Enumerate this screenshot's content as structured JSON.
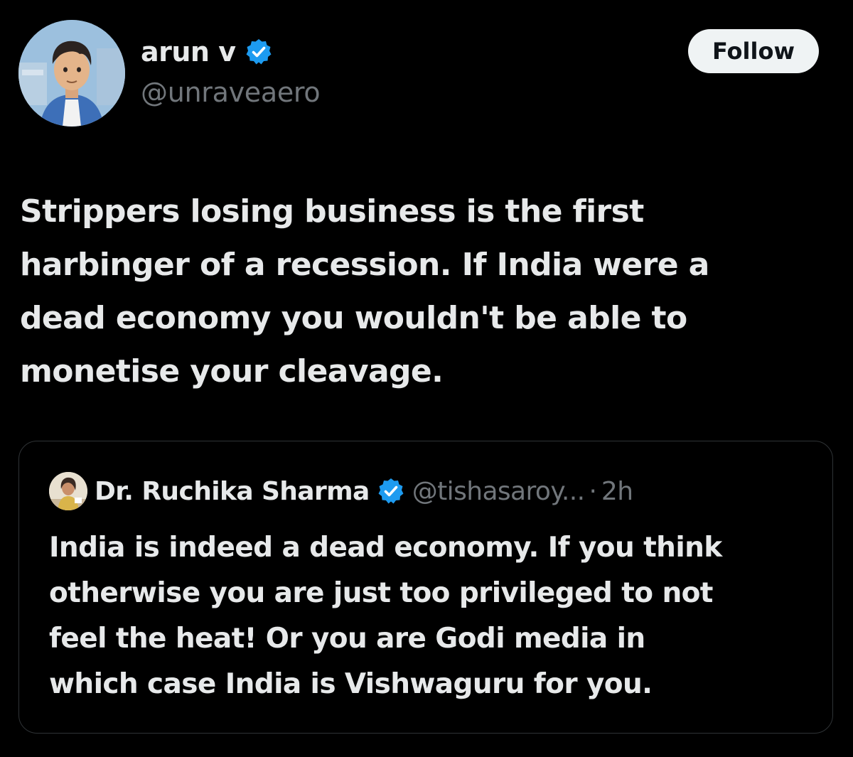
{
  "tweet": {
    "author": {
      "display_name": "arun v",
      "handle": "@unraveaero",
      "avatar_icon": "cartoon-man-avatar",
      "verified": true
    },
    "follow_label": "Follow",
    "text": "Strippers losing business is the first\nharbinger of a recession.  If India were a\ndead economy you wouldn't be able to\nmonetise your cleavage."
  },
  "quoted_tweet": {
    "author": {
      "display_name": "Dr. Ruchika Sharma",
      "handle": "@tishasaroy...",
      "avatar_icon": "woman-avatar",
      "verified": true
    },
    "separator": "·",
    "time": "2h",
    "text": "India is indeed a dead economy. If you think\notherwise you are just too privileged to not\nfeel the heat! Or you are Godi media in\nwhich case India is Vishwaguru for you."
  },
  "colors": {
    "background": "#000000",
    "primary_text": "#e7e9ea",
    "secondary_text": "#71767b",
    "verified_badge": "#1d9bf0",
    "border": "#2f3336",
    "follow_button_bg": "#eff3f4"
  }
}
